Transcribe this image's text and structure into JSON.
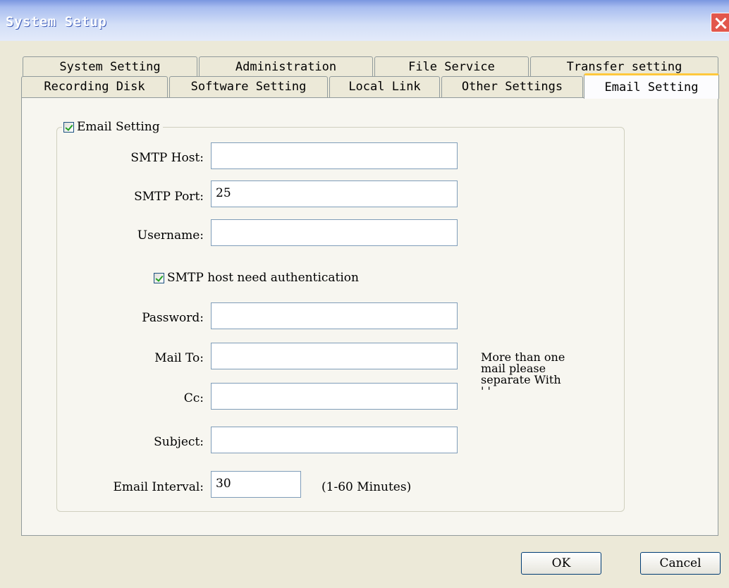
{
  "window": {
    "title": "System Setup"
  },
  "tabs": {
    "row1": [
      "System Setting",
      "Administration",
      "File Service",
      "Transfer setting"
    ],
    "row2": [
      "Recording Disk",
      "Software Setting",
      "Local Link",
      "Other Settings",
      "Email Setting"
    ],
    "active": "Email Setting"
  },
  "email_group": {
    "title": "Email Setting",
    "enabled": true,
    "smtp_host_label": "SMTP Host:",
    "smtp_host_value": "",
    "smtp_port_label": "SMTP Port:",
    "smtp_port_value": "25",
    "username_label": "Username:",
    "username_value": "",
    "auth_label": "SMTP host need authentication",
    "auth_checked": true,
    "password_label": "Password:",
    "password_value": "",
    "mail_to_label": "Mail To:",
    "mail_to_value": "",
    "cc_label": "Cc:",
    "cc_value": "",
    "subject_label": "Subject:",
    "subject_value": "",
    "interval_label": "Email Interval:",
    "interval_value": "30",
    "interval_unit": "(1-60 Minutes)",
    "note_lines": [
      "More than one",
      "mail please",
      "separate With",
      "' '"
    ]
  },
  "buttons": {
    "ok": "OK",
    "cancel": "Cancel"
  },
  "colors": {
    "title_bar_start": "#7a96df",
    "title_bar_end": "#e3eafa",
    "close_button": "#e2574c",
    "active_tab_accent": "#ffc83c",
    "dialog_bg": "#ece9d8",
    "panel_bg": "#f7f6f0",
    "checkmark": "#21a121"
  }
}
